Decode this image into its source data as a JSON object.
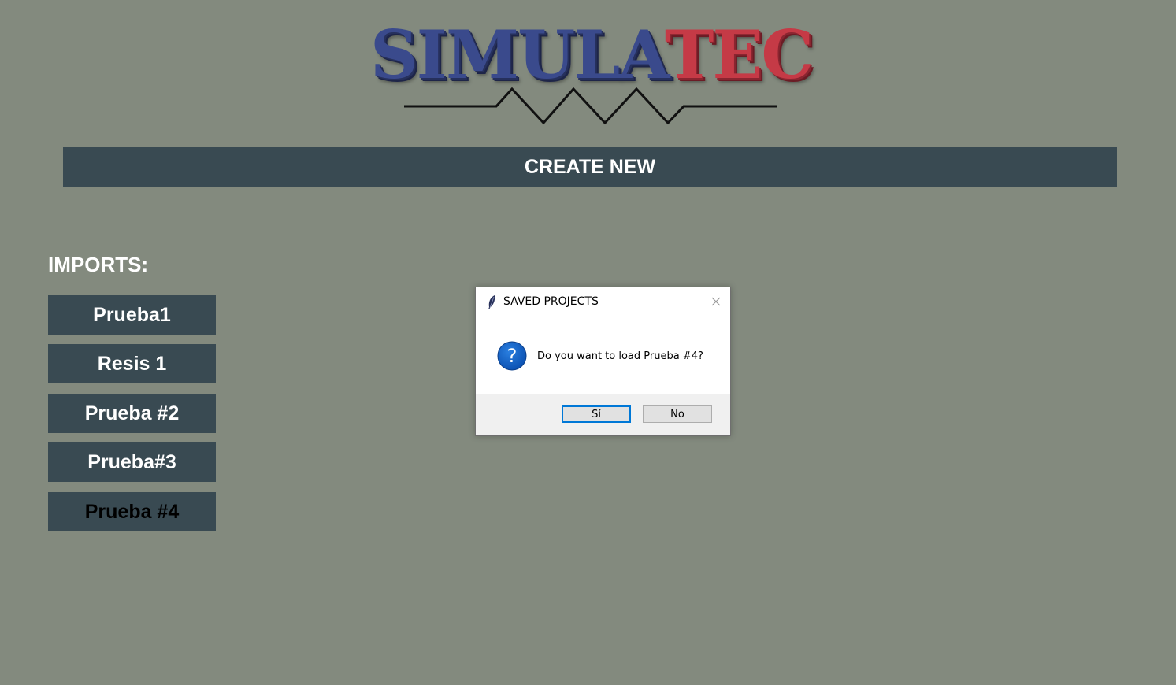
{
  "logo": {
    "text_blue": "SIMULA",
    "text_red": "TEC",
    "icon": "resistor-zigzag-icon"
  },
  "create_new": {
    "label": "CREATE NEW"
  },
  "imports": {
    "label": "IMPORTS:",
    "items": [
      {
        "label": "Prueba1"
      },
      {
        "label": "Resis 1"
      },
      {
        "label": "Prueba #2"
      },
      {
        "label": "Prueba#3"
      },
      {
        "label": "Prueba #4"
      }
    ]
  },
  "dialog": {
    "title": "SAVED PROJECTS",
    "title_icon": "feather-icon",
    "message_icon": "question-icon",
    "message": "Do you want to load Prueba #4?",
    "yes_label": "Sí",
    "no_label": "No"
  },
  "colors": {
    "background": "#838a7e",
    "button": "#394a52",
    "logo_blue": "#3a4a8c",
    "logo_red": "#c53a46",
    "dialog_accent": "#0078d7"
  }
}
